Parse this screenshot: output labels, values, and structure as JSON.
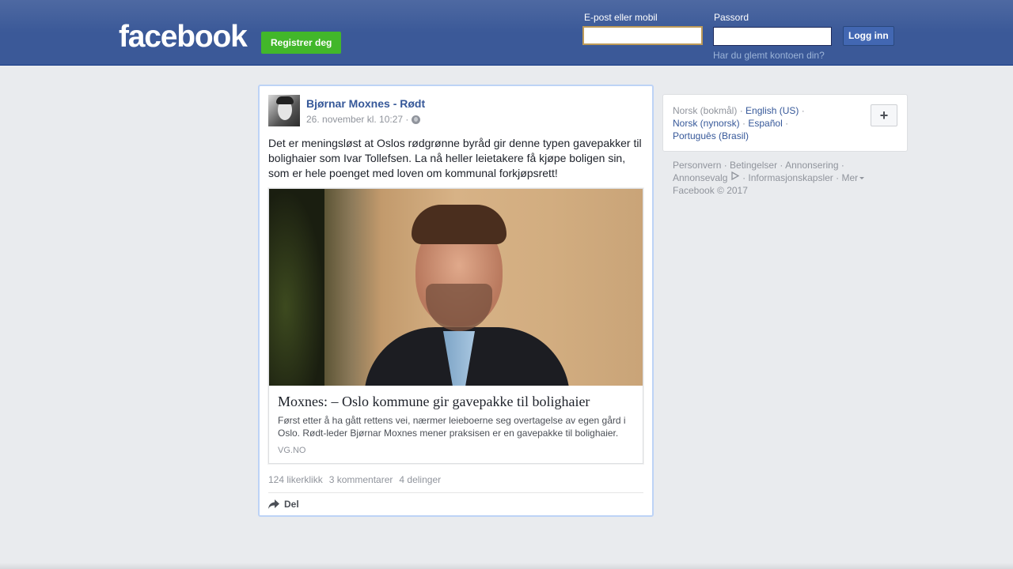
{
  "header": {
    "logo": "facebook",
    "register_label": "Registrer deg",
    "email_label": "E-post eller mobil",
    "email_value": "",
    "password_label": "Passord",
    "password_value": "",
    "login_label": "Logg inn",
    "forgot_label": "Har du glemt kontoen din?"
  },
  "post": {
    "author": "Bjørnar Moxnes - Rødt",
    "timestamp": "26. november kl. 10:27 ·",
    "text": "Det er meningsløst at Oslos rødgrønne byråd gir denne typen gavepakker til bolighaier som Ivar Tollefsen. La nå heller leietakere få kjøpe boligen sin, som er hele poenget med loven om kommunal forkjøpsrett!",
    "link": {
      "title": "Moxnes: – Oslo kommune gir gavepakke til bolighaier",
      "description": "Først etter å ha gått rettens vei, nærmer leieboerne seg overtagelse av egen gård i Oslo. Rødt-leder Bjørnar Moxnes mener praksisen er en gavepakke til bolighaier.",
      "domain": "VG.NO"
    },
    "stats": {
      "likes": "124 likerklikk",
      "comments": "3 kommentarer",
      "shares": "4 delinger"
    },
    "share_label": "Del"
  },
  "languages": {
    "current": "Norsk (bokmål)",
    "sep": "·",
    "options": [
      "English (US)",
      "Norsk (nynorsk)",
      "Español",
      "Português (Brasil)"
    ],
    "plus": "+"
  },
  "footer": {
    "links": [
      "Personvern",
      "Betingelser",
      "Annonsering",
      "Annonsevalg",
      "Informasjonskapsler",
      "Mer"
    ],
    "copyright": "Facebook © 2017"
  },
  "colors": {
    "brand": "#3b5998",
    "register_green": "#42b72a",
    "link_blue": "#365899"
  },
  "icons": {
    "share": "share-arrow-icon",
    "globe": "globe-icon",
    "adchoices": "adchoices-icon"
  }
}
